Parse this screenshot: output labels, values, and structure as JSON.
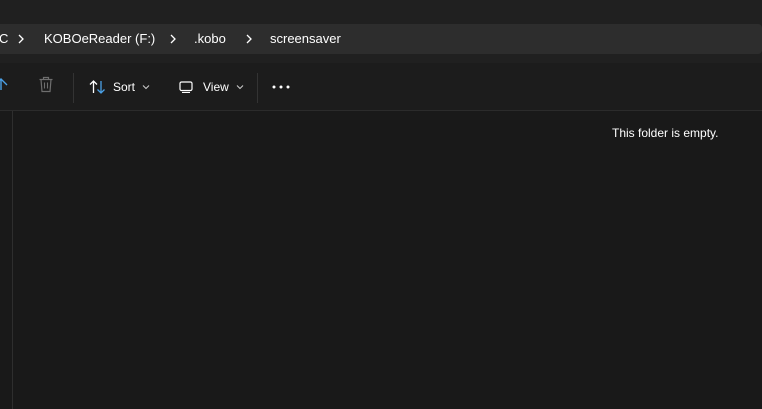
{
  "breadcrumb": {
    "items": [
      {
        "label": "C"
      },
      {
        "label": "KOBOeReader (F:)"
      },
      {
        "label": ".kobo"
      },
      {
        "label": "screensaver"
      }
    ]
  },
  "toolbar": {
    "sort_label": "Sort",
    "view_label": "View"
  },
  "main": {
    "empty_message": "This folder is empty."
  },
  "colors": {
    "background": "#191919",
    "address_bar": "#2d2d2d",
    "accent_icon": "#4aa0e6"
  },
  "icons": [
    "share-icon",
    "delete-icon",
    "sort-icon",
    "chevron-down-icon",
    "view-icon",
    "more-icon",
    "chevron-right-icon"
  ]
}
